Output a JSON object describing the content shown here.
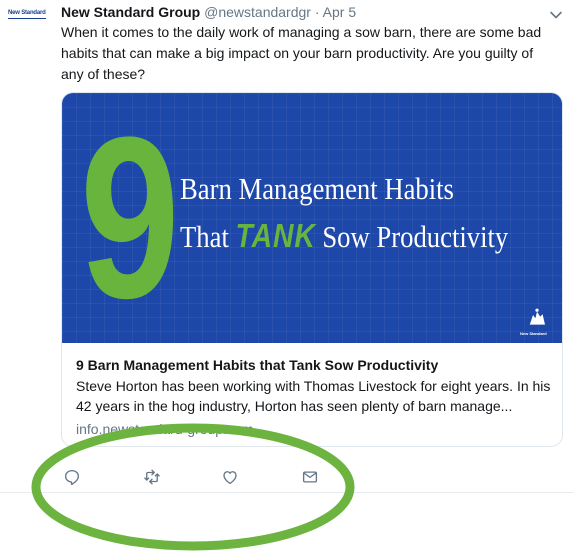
{
  "tweet": {
    "avatar_text": "New Standard",
    "author_name": "New Standard Group",
    "handle": "@newstandardgr",
    "separator": "·",
    "date": "Apr 5",
    "text": "When it comes to the daily work of managing a sow barn, there are some bad habits that can make a big impact on your barn productivity. Are you guilty of any of these?"
  },
  "card": {
    "image": {
      "big_number": "9",
      "headline_line1": "Barn Management Habits",
      "headline_line2_before": "That ",
      "headline_line2_emphasis": "TANK",
      "headline_line2_after": " Sow Productivity",
      "brand_label": "New Standard",
      "colors": {
        "background": "#1d47a8",
        "accent": "#69b43c",
        "text": "#ffffff"
      }
    },
    "title": "9 Barn Management Habits that Tank Sow Productivity",
    "description": "Steve Horton has been working with Thomas Livestock for eight years. In his 42 years in the hog industry, Horton has seen plenty of barn manage...",
    "url": "info.newstandard-group.com"
  },
  "actions": [
    {
      "name": "reply-icon",
      "icon": "speech-bubble"
    },
    {
      "name": "retweet-icon",
      "icon": "retweet-arrows"
    },
    {
      "name": "like-icon",
      "icon": "heart"
    },
    {
      "name": "direct-message-icon",
      "icon": "envelope"
    }
  ],
  "annotation": {
    "color": "#6cb33f"
  }
}
